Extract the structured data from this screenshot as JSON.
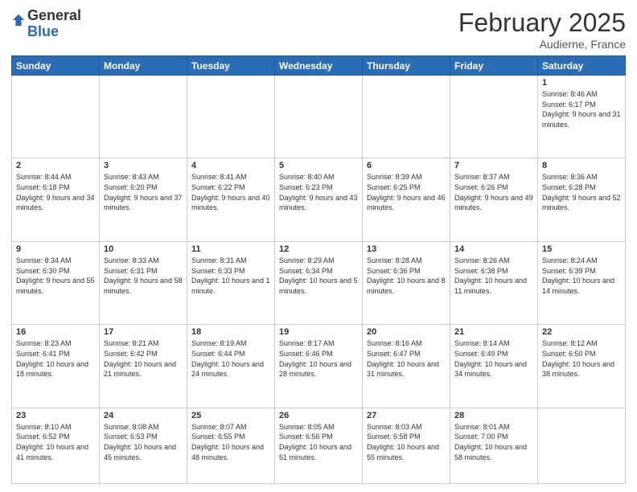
{
  "logo": {
    "general": "General",
    "blue": "Blue"
  },
  "header": {
    "month": "February 2025",
    "location": "Audierne, France"
  },
  "weekdays": [
    "Sunday",
    "Monday",
    "Tuesday",
    "Wednesday",
    "Thursday",
    "Friday",
    "Saturday"
  ],
  "weeks": [
    [
      {
        "day": "",
        "info": ""
      },
      {
        "day": "",
        "info": ""
      },
      {
        "day": "",
        "info": ""
      },
      {
        "day": "",
        "info": ""
      },
      {
        "day": "",
        "info": ""
      },
      {
        "day": "",
        "info": ""
      },
      {
        "day": "1",
        "info": "Sunrise: 8:46 AM\nSunset: 6:17 PM\nDaylight: 9 hours and 31 minutes."
      }
    ],
    [
      {
        "day": "2",
        "info": "Sunrise: 8:44 AM\nSunset: 6:18 PM\nDaylight: 9 hours and 34 minutes."
      },
      {
        "day": "3",
        "info": "Sunrise: 8:43 AM\nSunset: 6:20 PM\nDaylight: 9 hours and 37 minutes."
      },
      {
        "day": "4",
        "info": "Sunrise: 8:41 AM\nSunset: 6:22 PM\nDaylight: 9 hours and 40 minutes."
      },
      {
        "day": "5",
        "info": "Sunrise: 8:40 AM\nSunset: 6:23 PM\nDaylight: 9 hours and 43 minutes."
      },
      {
        "day": "6",
        "info": "Sunrise: 8:39 AM\nSunset: 6:25 PM\nDaylight: 9 hours and 46 minutes."
      },
      {
        "day": "7",
        "info": "Sunrise: 8:37 AM\nSunset: 6:26 PM\nDaylight: 9 hours and 49 minutes."
      },
      {
        "day": "8",
        "info": "Sunrise: 8:36 AM\nSunset: 6:28 PM\nDaylight: 9 hours and 52 minutes."
      }
    ],
    [
      {
        "day": "9",
        "info": "Sunrise: 8:34 AM\nSunset: 6:30 PM\nDaylight: 9 hours and 55 minutes."
      },
      {
        "day": "10",
        "info": "Sunrise: 8:33 AM\nSunset: 6:31 PM\nDaylight: 9 hours and 58 minutes."
      },
      {
        "day": "11",
        "info": "Sunrise: 8:31 AM\nSunset: 6:33 PM\nDaylight: 10 hours and 1 minute."
      },
      {
        "day": "12",
        "info": "Sunrise: 8:29 AM\nSunset: 6:34 PM\nDaylight: 10 hours and 5 minutes."
      },
      {
        "day": "13",
        "info": "Sunrise: 8:28 AM\nSunset: 6:36 PM\nDaylight: 10 hours and 8 minutes."
      },
      {
        "day": "14",
        "info": "Sunrise: 8:26 AM\nSunset: 6:38 PM\nDaylight: 10 hours and 11 minutes."
      },
      {
        "day": "15",
        "info": "Sunrise: 8:24 AM\nSunset: 6:39 PM\nDaylight: 10 hours and 14 minutes."
      }
    ],
    [
      {
        "day": "16",
        "info": "Sunrise: 8:23 AM\nSunset: 6:41 PM\nDaylight: 10 hours and 18 minutes."
      },
      {
        "day": "17",
        "info": "Sunrise: 8:21 AM\nSunset: 6:42 PM\nDaylight: 10 hours and 21 minutes."
      },
      {
        "day": "18",
        "info": "Sunrise: 8:19 AM\nSunset: 6:44 PM\nDaylight: 10 hours and 24 minutes."
      },
      {
        "day": "19",
        "info": "Sunrise: 8:17 AM\nSunset: 6:46 PM\nDaylight: 10 hours and 28 minutes."
      },
      {
        "day": "20",
        "info": "Sunrise: 8:16 AM\nSunset: 6:47 PM\nDaylight: 10 hours and 31 minutes."
      },
      {
        "day": "21",
        "info": "Sunrise: 8:14 AM\nSunset: 6:49 PM\nDaylight: 10 hours and 34 minutes."
      },
      {
        "day": "22",
        "info": "Sunrise: 8:12 AM\nSunset: 6:50 PM\nDaylight: 10 hours and 38 minutes."
      }
    ],
    [
      {
        "day": "23",
        "info": "Sunrise: 8:10 AM\nSunset: 6:52 PM\nDaylight: 10 hours and 41 minutes."
      },
      {
        "day": "24",
        "info": "Sunrise: 8:08 AM\nSunset: 6:53 PM\nDaylight: 10 hours and 45 minutes."
      },
      {
        "day": "25",
        "info": "Sunrise: 8:07 AM\nSunset: 6:55 PM\nDaylight: 10 hours and 48 minutes."
      },
      {
        "day": "26",
        "info": "Sunrise: 8:05 AM\nSunset: 6:56 PM\nDaylight: 10 hours and 51 minutes."
      },
      {
        "day": "27",
        "info": "Sunrise: 8:03 AM\nSunset: 6:58 PM\nDaylight: 10 hours and 55 minutes."
      },
      {
        "day": "28",
        "info": "Sunrise: 8:01 AM\nSunset: 7:00 PM\nDaylight: 10 hours and 58 minutes."
      },
      {
        "day": "",
        "info": ""
      }
    ]
  ]
}
